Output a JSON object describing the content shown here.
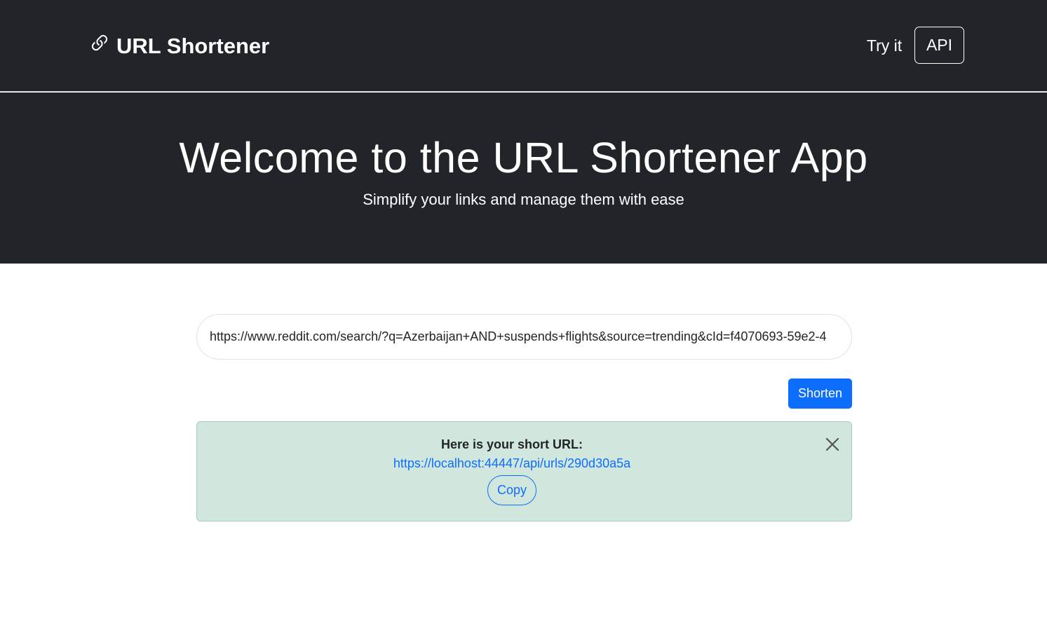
{
  "header": {
    "brand_label": "URL Shortener",
    "brand_icon": "link-icon",
    "nav_try_label": "Try it",
    "nav_api_label": "API"
  },
  "hero": {
    "title": "Welcome to the URL Shortener App",
    "subtitle": "Simplify your links and manage them with ease"
  },
  "form": {
    "url_value": "https://www.reddit.com/search/?q=Azerbaijan+AND+suspends+flights&source=trending&cId=f4070693-59e2-4",
    "shorten_label": "Shorten"
  },
  "result": {
    "heading": "Here is your short URL:",
    "short_url": "https://localhost:44447/api/urls/290d30a5a",
    "copy_label": "Copy",
    "close_icon": "close-icon"
  },
  "colors": {
    "dark_bg": "#212529",
    "primary": "#0d6efd",
    "success_bg": "#d1e7dd",
    "success_border": "#a3cfbb"
  }
}
